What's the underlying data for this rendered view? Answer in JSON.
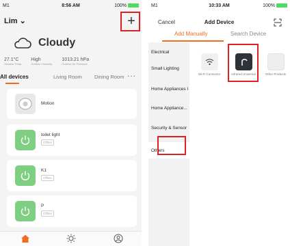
{
  "left": {
    "status": {
      "carrier": "M1",
      "time": "8:56 AM",
      "battery": "100%"
    },
    "home_name": "Lim",
    "add_button": "+",
    "weather": {
      "condition": "Cloudy",
      "icon": "cloud-icon"
    },
    "stats": [
      {
        "value": "27.1°C",
        "label": "Outdoor Temp"
      },
      {
        "value": "High",
        "label": "Outdoor Humidity"
      },
      {
        "value": "1013.21 hPa",
        "label": "Outdoor Air Pressure"
      }
    ],
    "tabs": [
      "All devices",
      "Living Room",
      "Dining Room"
    ],
    "more": "···",
    "devices": [
      {
        "name": "Motion",
        "status": "",
        "icon": "motion-sensor-icon"
      },
      {
        "name": "toilet light",
        "status": "Offline",
        "icon": "power-icon"
      },
      {
        "name": "K1",
        "status": "Offline",
        "icon": "power-icon"
      },
      {
        "name": "P",
        "status": "Offline",
        "icon": "power-icon"
      }
    ],
    "tabbar": [
      "home-icon",
      "sun-icon",
      "profile-icon"
    ],
    "accent": "#f36b21",
    "device_green": "#7ecf82"
  },
  "right": {
    "status": {
      "carrier": "M1",
      "time": "10:33 AM",
      "battery": "100%"
    },
    "cancel": "Cancel",
    "title": "Add Device",
    "segments": {
      "manual": "Add Manually",
      "search": "Search Device"
    },
    "categories": [
      "Electrical",
      "Small Lighting",
      "Home Appliances I",
      "Home Appliance...",
      "Security & Sensor",
      "Others"
    ],
    "products": [
      {
        "name": "Wi-Fi Connector",
        "icon": "wifi-icon"
      },
      {
        "name": "Infrared Universal",
        "icon": "infrared-remote-icon"
      },
      {
        "name": "Other Products",
        "icon": "box-icon"
      }
    ],
    "highlight": "#e02020"
  }
}
